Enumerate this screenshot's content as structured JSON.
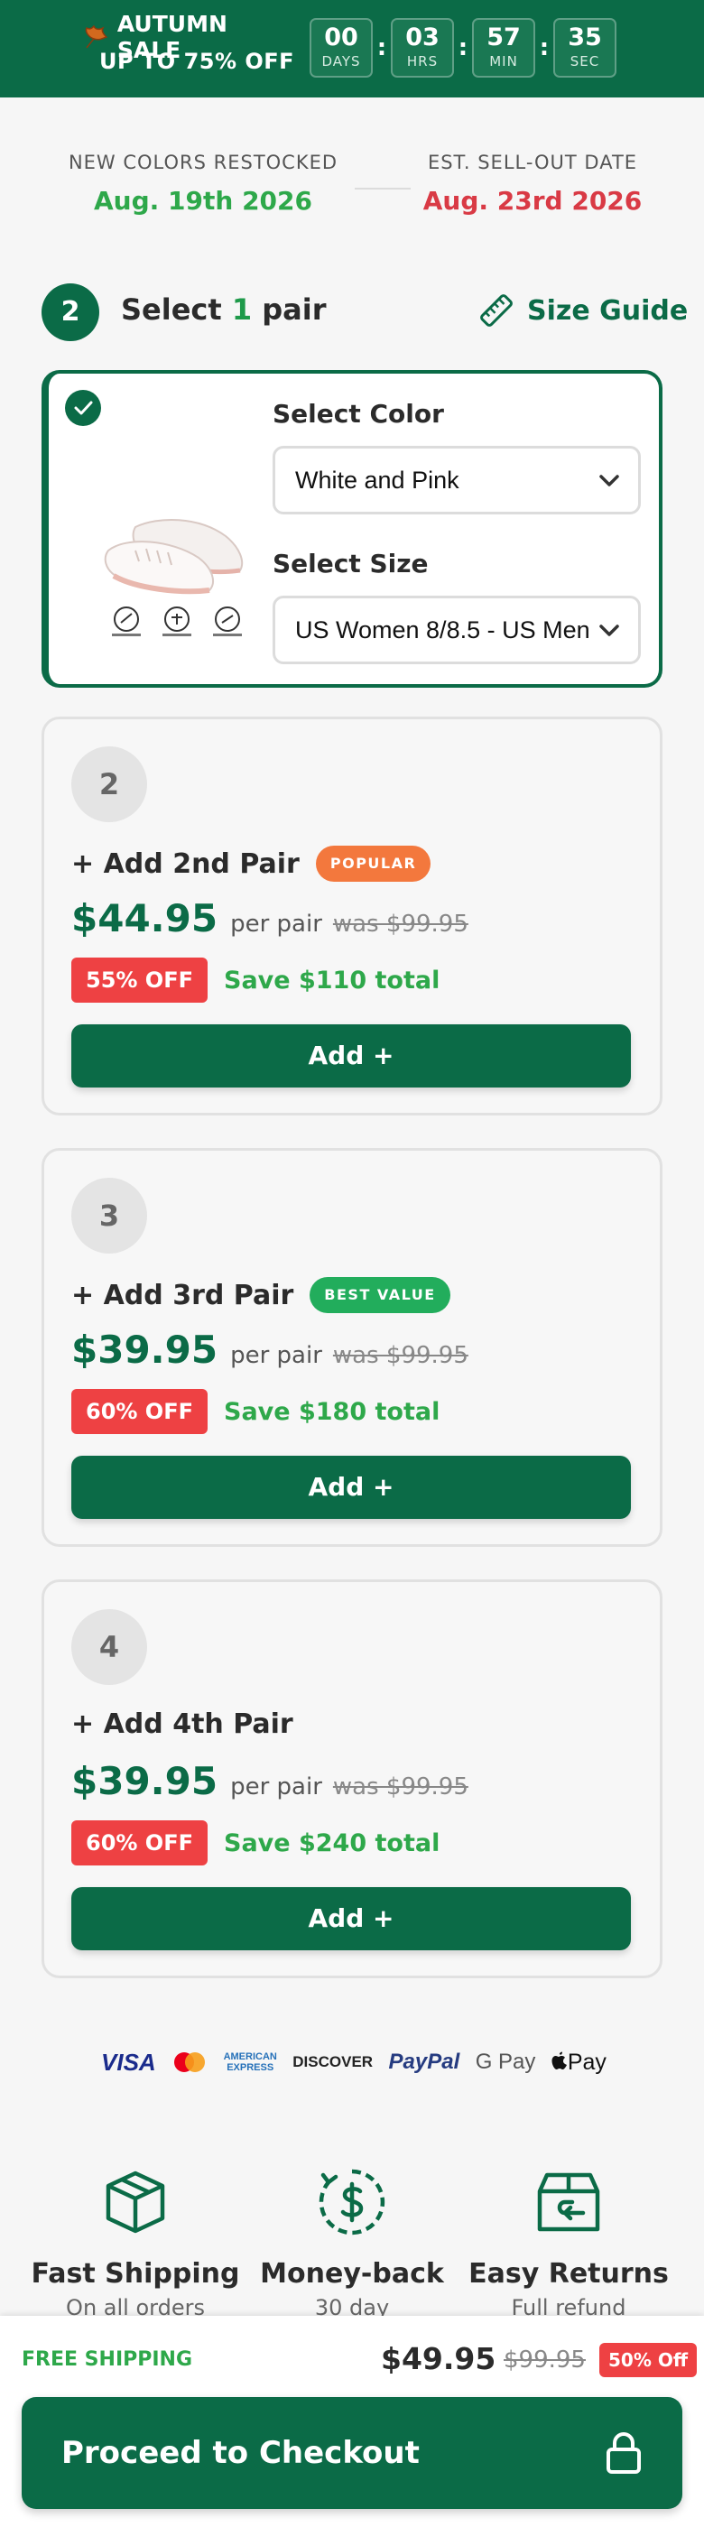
{
  "banner": {
    "title": "AUTUMN SALE",
    "subtitle": "UP TO 75% OFF",
    "countdown": [
      {
        "value": "00",
        "label": "DAYS"
      },
      {
        "value": "03",
        "label": "HRS"
      },
      {
        "value": "57",
        "label": "MIN"
      },
      {
        "value": "35",
        "label": "SEC"
      }
    ]
  },
  "restock": {
    "left_label": "NEW COLORS RESTOCKED",
    "left_date": "Aug. 19th 2026",
    "right_label": "EST. SELL-OUT DATE",
    "right_date": "Aug. 23rd 2026"
  },
  "step": {
    "number": "2",
    "title_pre": "Select ",
    "title_num": "1",
    "title_post": " pair",
    "size_guide": "Size Guide"
  },
  "selected": {
    "color_label": "Select Color",
    "color_value": "White and Pink",
    "size_label": "Select Size",
    "size_value": "US Women 8/8.5 - US Men"
  },
  "offers": [
    {
      "qty": "2",
      "title": "+ Add 2nd Pair",
      "tag": "POPULAR",
      "price": "$44.95",
      "per": "per pair",
      "was": "was $99.95",
      "off": "55% OFF",
      "save": "Save $110 total",
      "button": "Add +"
    },
    {
      "qty": "3",
      "title": "+ Add 3rd Pair",
      "tag": "BEST VALUE",
      "price": "$39.95",
      "per": "per pair",
      "was": "was $99.95",
      "off": "60% OFF",
      "save": "Save $180 total",
      "button": "Add +"
    },
    {
      "qty": "4",
      "title": "+ Add 4th Pair",
      "tag": "",
      "price": "$39.95",
      "per": "per pair",
      "was": "was $99.95",
      "off": "60% OFF",
      "save": "Save $240 total",
      "button": "Add +"
    }
  ],
  "payments": {
    "visa": "VISA",
    "amex_1": "AMERICAN",
    "amex_2": "EXPRESS",
    "discover": "DISCOVER",
    "paypal": "PayPal",
    "gpay": "G Pay",
    "applepay": "Pay"
  },
  "features": [
    {
      "title": "Fast Shipping",
      "sub": "On all orders",
      "icon": "box-icon"
    },
    {
      "title": "Money-back",
      "sub": "30 day",
      "icon": "dollar-cycle-icon"
    },
    {
      "title": "Easy Returns",
      "sub": "Full refund",
      "icon": "return-box-icon"
    }
  ],
  "sticky": {
    "free_shipping": "FREE SHIPPING",
    "price": "$49.95",
    "was": "$99.95",
    "off": "50% Off",
    "checkout": "Proceed to Checkout"
  },
  "colors": {
    "brand_green": "#0b6b47",
    "accent_green": "#2ea84a",
    "sale_red": "#ee4143",
    "date_red": "#d93a45",
    "tag_orange": "#f3783d"
  }
}
